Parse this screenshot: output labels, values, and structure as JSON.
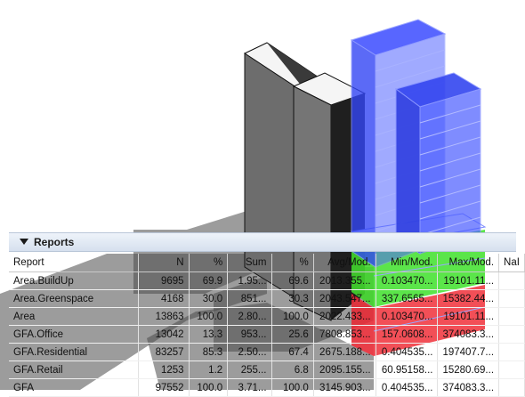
{
  "reports": {
    "title": "Reports",
    "columns": [
      "Report",
      "N",
      "%",
      "Sum",
      "%",
      "Avg/Mod.",
      "Min/Mod.",
      "Max/Mod.",
      "NaI"
    ],
    "rows": [
      [
        "Area.BuildUp",
        "9695",
        "69.9",
        "1.95...",
        "69.6",
        "2013.355...",
        "0.103470...",
        "19101.11..."
      ],
      [
        "Area.Greenspace",
        "4168",
        "30.0",
        "851...",
        "30.3",
        "2043.547...",
        "337.6565...",
        "15382.44..."
      ],
      [
        "Area",
        "13863",
        "100.0",
        "2.80...",
        "100.0",
        "2022.433...",
        "0.103470...",
        "19101.11..."
      ],
      [
        "GFA.Office",
        "13042",
        "13.3",
        "953...",
        "25.6",
        "7808.853...",
        "157.0608...",
        "374083.3..."
      ],
      [
        "GFA.Residential",
        "83257",
        "85.3",
        "2.50...",
        "67.4",
        "2675.188...",
        "0.404535...",
        "197407.7..."
      ],
      [
        "GFA.Retail",
        "1253",
        "1.2",
        "255...",
        "6.8",
        "2095.155...",
        "60.95158...",
        "15280.69..."
      ],
      [
        "GFA",
        "97552",
        "100.0",
        "3.71...",
        "100.0",
        "3145.903...",
        "0.404535...",
        "374083.3..."
      ]
    ]
  },
  "colors": {
    "selection_blue": "#3f51ff",
    "green_floor": "#3ee02a",
    "red_floor": "#f0303a",
    "gray_tower": "#6b6b6b"
  }
}
